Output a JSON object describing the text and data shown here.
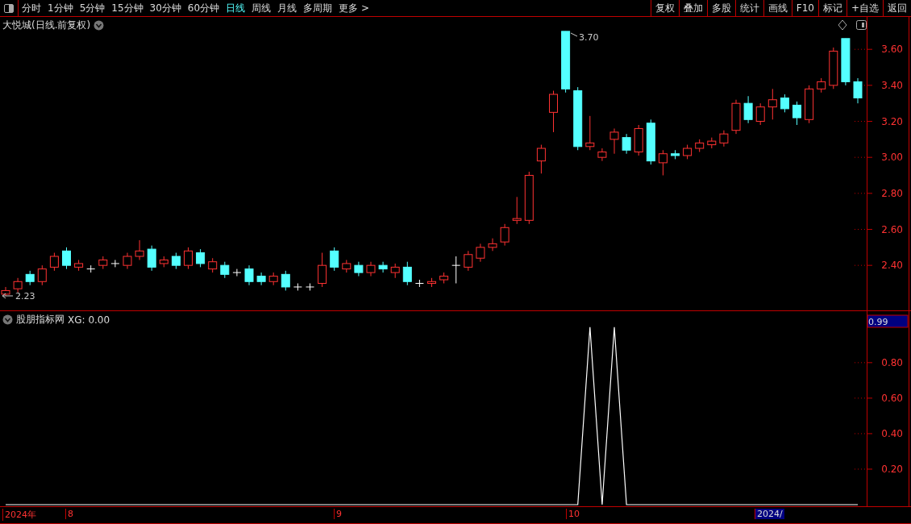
{
  "toolbar": {
    "periods": [
      {
        "label": "分时",
        "selected": false
      },
      {
        "label": "1分钟",
        "selected": false
      },
      {
        "label": "5分钟",
        "selected": false
      },
      {
        "label": "15分钟",
        "selected": false
      },
      {
        "label": "30分钟",
        "selected": false
      },
      {
        "label": "60分钟",
        "selected": false
      },
      {
        "label": "日线",
        "selected": true
      },
      {
        "label": "周线",
        "selected": false
      },
      {
        "label": "月线",
        "selected": false
      },
      {
        "label": "多周期",
        "selected": false
      },
      {
        "label": "更多 >",
        "selected": false
      }
    ],
    "buttons": [
      "复权",
      "叠加",
      "多股",
      "统计",
      "画线",
      "F10",
      "标记",
      "+自选",
      "返回"
    ]
  },
  "price_chart": {
    "title": "大悦城(日线.前复权)",
    "high_label": "3.70",
    "low_label": "2.23",
    "chart_data": {
      "type": "candlestick",
      "ylim": [
        2.15,
        3.78
      ],
      "yticks": [
        {
          "value": 3.6,
          "label": "3.60"
        },
        {
          "value": 3.4,
          "label": "3.40"
        },
        {
          "value": 3.2,
          "label": "3.20"
        },
        {
          "value": 3.0,
          "label": "3.00"
        },
        {
          "value": 2.8,
          "label": "2.80"
        },
        {
          "value": 2.6,
          "label": "2.60"
        },
        {
          "value": 2.4,
          "label": "2.40"
        }
      ],
      "ohlc": [
        [
          2.24,
          2.28,
          2.23,
          2.26
        ],
        [
          2.27,
          2.33,
          2.25,
          2.31
        ],
        [
          2.35,
          2.37,
          2.29,
          2.31
        ],
        [
          2.31,
          2.4,
          2.29,
          2.38
        ],
        [
          2.39,
          2.47,
          2.37,
          2.45
        ],
        [
          2.48,
          2.5,
          2.38,
          2.4
        ],
        [
          2.39,
          2.43,
          2.37,
          2.41
        ],
        [
          2.38,
          2.4,
          2.36,
          2.38
        ],
        [
          2.4,
          2.45,
          2.38,
          2.43
        ],
        [
          2.41,
          2.43,
          2.39,
          2.41
        ],
        [
          2.4,
          2.47,
          2.38,
          2.45
        ],
        [
          2.45,
          2.54,
          2.43,
          2.48
        ],
        [
          2.49,
          2.51,
          2.37,
          2.39
        ],
        [
          2.41,
          2.45,
          2.39,
          2.43
        ],
        [
          2.45,
          2.47,
          2.38,
          2.4
        ],
        [
          2.4,
          2.5,
          2.38,
          2.48
        ],
        [
          2.47,
          2.49,
          2.39,
          2.41
        ],
        [
          2.38,
          2.44,
          2.36,
          2.42
        ],
        [
          2.4,
          2.42,
          2.33,
          2.35
        ],
        [
          2.36,
          2.38,
          2.34,
          2.36
        ],
        [
          2.38,
          2.4,
          2.29,
          2.31
        ],
        [
          2.34,
          2.36,
          2.29,
          2.31
        ],
        [
          2.31,
          2.36,
          2.29,
          2.34
        ],
        [
          2.35,
          2.37,
          2.26,
          2.28
        ],
        [
          2.28,
          2.3,
          2.26,
          2.28
        ],
        [
          2.28,
          2.3,
          2.26,
          2.28
        ],
        [
          2.3,
          2.47,
          2.28,
          2.4
        ],
        [
          2.48,
          2.5,
          2.37,
          2.39
        ],
        [
          2.38,
          2.43,
          2.36,
          2.41
        ],
        [
          2.4,
          2.42,
          2.34,
          2.36
        ],
        [
          2.36,
          2.42,
          2.34,
          2.4
        ],
        [
          2.4,
          2.42,
          2.36,
          2.38
        ],
        [
          2.36,
          2.41,
          2.33,
          2.39
        ],
        [
          2.39,
          2.42,
          2.29,
          2.31
        ],
        [
          2.3,
          2.32,
          2.28,
          2.3
        ],
        [
          2.3,
          2.33,
          2.28,
          2.31
        ],
        [
          2.32,
          2.36,
          2.3,
          2.34
        ],
        [
          2.4,
          2.45,
          2.3,
          2.4
        ],
        [
          2.39,
          2.48,
          2.37,
          2.46
        ],
        [
          2.44,
          2.52,
          2.42,
          2.5
        ],
        [
          2.5,
          2.55,
          2.48,
          2.52
        ],
        [
          2.53,
          2.63,
          2.51,
          2.61
        ],
        [
          2.65,
          2.78,
          2.63,
          2.66
        ],
        [
          2.65,
          2.92,
          2.63,
          2.9
        ],
        [
          2.98,
          3.07,
          2.91,
          3.05
        ],
        [
          3.25,
          3.37,
          3.14,
          3.35
        ],
        [
          3.7,
          3.7,
          3.36,
          3.38
        ],
        [
          3.37,
          3.39,
          3.04,
          3.06
        ],
        [
          3.06,
          3.23,
          3.04,
          3.08
        ],
        [
          3.0,
          3.05,
          2.98,
          3.03
        ],
        [
          3.1,
          3.16,
          3.02,
          3.14
        ],
        [
          3.11,
          3.13,
          3.02,
          3.04
        ],
        [
          3.03,
          3.18,
          3.01,
          3.16
        ],
        [
          3.19,
          3.21,
          2.96,
          2.98
        ],
        [
          2.97,
          3.04,
          2.9,
          3.02
        ],
        [
          3.02,
          3.04,
          2.99,
          3.01
        ],
        [
          3.01,
          3.07,
          2.99,
          3.05
        ],
        [
          3.05,
          3.1,
          3.03,
          3.08
        ],
        [
          3.07,
          3.11,
          3.05,
          3.09
        ],
        [
          3.08,
          3.15,
          3.06,
          3.13
        ],
        [
          3.15,
          3.32,
          3.13,
          3.3
        ],
        [
          3.3,
          3.34,
          3.19,
          3.21
        ],
        [
          3.2,
          3.3,
          3.18,
          3.28
        ],
        [
          3.28,
          3.38,
          3.21,
          3.32
        ],
        [
          3.33,
          3.35,
          3.25,
          3.27
        ],
        [
          3.29,
          3.31,
          3.18,
          3.22
        ],
        [
          3.21,
          3.4,
          3.19,
          3.38
        ],
        [
          3.38,
          3.44,
          3.36,
          3.42
        ],
        [
          3.4,
          3.61,
          3.38,
          3.59
        ],
        [
          3.66,
          3.66,
          3.4,
          3.42
        ],
        [
          3.42,
          3.44,
          3.3,
          3.33
        ]
      ]
    }
  },
  "indicator": {
    "name": "股朋指标网",
    "reading": "XG: 0.00",
    "value_badge": "0.99",
    "chart_data": {
      "type": "line",
      "ylim": [
        0,
        1.09
      ],
      "yticks": [
        {
          "value": 0.2,
          "label": "0.20"
        },
        {
          "value": 0.4,
          "label": "0.40"
        },
        {
          "value": 0.6,
          "label": "0.60"
        },
        {
          "value": 0.8,
          "label": "0.80"
        }
      ],
      "series": [
        {
          "color": "#ffffff",
          "values": [
            0,
            0,
            0,
            0,
            0,
            0,
            0,
            0,
            0,
            0,
            0,
            0,
            0,
            0,
            0,
            0,
            0,
            0,
            0,
            0,
            0,
            0,
            0,
            0,
            0,
            0,
            0,
            0,
            0,
            0,
            0,
            0,
            0,
            0,
            0,
            0,
            0,
            0,
            0,
            0,
            0,
            0,
            0,
            0,
            0,
            0,
            0,
            0,
            1,
            0,
            1,
            0,
            0,
            0,
            0,
            0,
            0,
            0,
            0,
            0,
            0,
            0,
            0,
            0,
            0,
            0,
            0,
            0,
            0,
            0,
            0
          ]
        }
      ]
    }
  },
  "time_axis": [
    {
      "label": "2024年",
      "selected": false
    },
    {
      "label": "8",
      "selected": false
    },
    {
      "label": "9",
      "selected": false
    },
    {
      "label": "10",
      "selected": false
    },
    {
      "label": "2024/",
      "selected": true
    }
  ]
}
